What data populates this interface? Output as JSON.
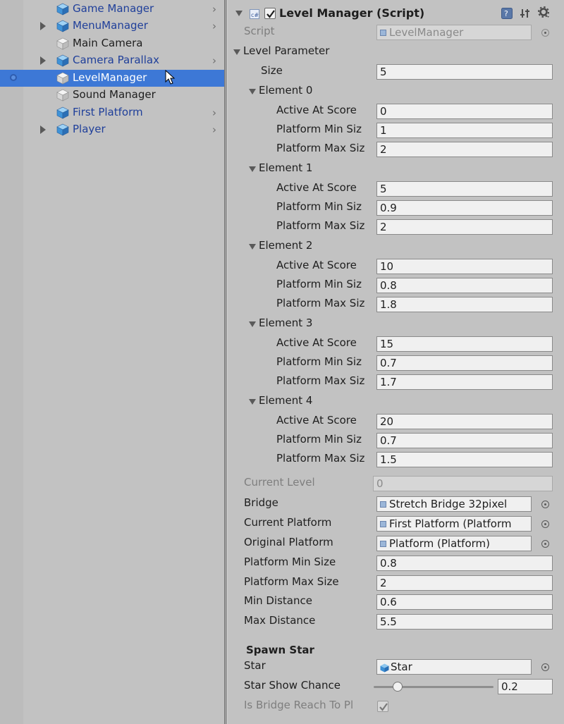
{
  "hierarchy": {
    "items": [
      {
        "label": "Game Manager",
        "prefab": true,
        "foldout": false,
        "chevron": true,
        "selected": false,
        "cube": "blue"
      },
      {
        "label": "MenuManager",
        "prefab": true,
        "foldout": true,
        "chevron": true,
        "selected": false,
        "cube": "blue"
      },
      {
        "label": "Main Camera",
        "prefab": false,
        "foldout": false,
        "chevron": false,
        "selected": false,
        "cube": "grey"
      },
      {
        "label": "Camera Parallax",
        "prefab": true,
        "foldout": true,
        "chevron": true,
        "selected": false,
        "cube": "blue"
      },
      {
        "label": "LevelManager",
        "prefab": false,
        "foldout": false,
        "chevron": false,
        "selected": true,
        "cube": "grey"
      },
      {
        "label": "Sound Manager",
        "prefab": false,
        "foldout": false,
        "chevron": false,
        "selected": false,
        "cube": "grey"
      },
      {
        "label": "First Platform",
        "prefab": true,
        "foldout": false,
        "chevron": true,
        "selected": false,
        "cube": "blue"
      },
      {
        "label": "Player",
        "prefab": true,
        "foldout": true,
        "chevron": true,
        "selected": false,
        "cube": "blue"
      }
    ],
    "chevron_glyph": "›"
  },
  "inspector": {
    "component_title": "Level Manager (Script)",
    "script_label": "Script",
    "script_value": "LevelManager",
    "level_parameter_label": "Level Parameter",
    "size_label": "Size",
    "size_value": "5",
    "elements": [
      {
        "label": "Element 0",
        "active_at_score": "0",
        "min_size": "1",
        "max_size": "2"
      },
      {
        "label": "Element 1",
        "active_at_score": "5",
        "min_size": "0.9",
        "max_size": "2"
      },
      {
        "label": "Element 2",
        "active_at_score": "10",
        "min_size": "0.8",
        "max_size": "1.8"
      },
      {
        "label": "Element 3",
        "active_at_score": "15",
        "min_size": "0.7",
        "max_size": "1.7"
      },
      {
        "label": "Element 4",
        "active_at_score": "20",
        "min_size": "0.7",
        "max_size": "1.5"
      }
    ],
    "active_at_score_label": "Active At Score",
    "platform_min_siz_label": "Platform Min Siz",
    "platform_max_siz_label": "Platform Max Siz",
    "current_level_label": "Current Level",
    "current_level_value": "0",
    "bridge_label": "Bridge",
    "bridge_value": "Stretch Bridge 32pixel",
    "current_platform_label": "Current Platform",
    "current_platform_value": "First Platform (Platform",
    "original_platform_label": "Original Platform",
    "original_platform_value": "Platform (Platform)",
    "platform_min_size_label": "Platform Min Size",
    "platform_min_size_value": "0.8",
    "platform_max_size_label": "Platform Max Size",
    "platform_max_size_value": "2",
    "min_distance_label": "Min Distance",
    "min_distance_value": "0.6",
    "max_distance_label": "Max Distance",
    "max_distance_value": "5.5",
    "spawn_star_header": "Spawn Star",
    "star_label": "Star",
    "star_value": "Star",
    "star_show_chance_label": "Star Show Chance",
    "star_show_chance_value": "0.2",
    "star_show_chance_fraction": 0.2,
    "bridge_reach_label": "Is Bridge Reach To Pl",
    "bridge_reach_checked": true
  },
  "colors": {
    "selection": "#3d78d6",
    "prefab_text": "#1f3f9a",
    "panel_bg": "#c2c2c2"
  }
}
